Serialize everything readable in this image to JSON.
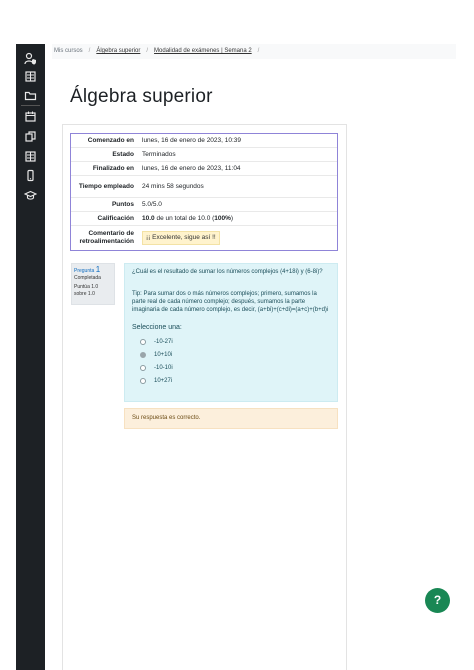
{
  "sidebar": {
    "icons": [
      "user-shield-icon",
      "book-icon",
      "folder-icon",
      "calendar-icon",
      "copy-icon",
      "book-icon",
      "mobile-icon",
      "graduation-cap-icon"
    ]
  },
  "breadcrumb": {
    "items": [
      "Mis cursos",
      "Álgebra superior",
      "Modalidad de exámenes | Semana 2"
    ]
  },
  "page": {
    "title": "Álgebra superior"
  },
  "summary": {
    "rows": [
      {
        "label": "Comenzado en",
        "value": "lunes, 16 de enero de 2023, 10:39"
      },
      {
        "label": "Estado",
        "value": "Terminados"
      },
      {
        "label": "Finalizado en",
        "value": "lunes, 16 de enero de 2023, 11:04"
      },
      {
        "label": "Tiempo empleado",
        "value": "24 mins 58 segundos"
      },
      {
        "label": "Puntos",
        "value": "5.0/5.0"
      },
      {
        "label": "Calificación",
        "value_bold": "10.0",
        "value_mid": " de un total de 10.0 (",
        "value_pct": "100%",
        "value_end": ")"
      },
      {
        "label": "Comentario de retroalimentación",
        "value": "¡¡ Excelente, sigue así !!"
      }
    ]
  },
  "question": {
    "label": "Pregunta",
    "number": "1",
    "status": "Completada",
    "score_line1": "Puntúa 1.0",
    "score_line2": "sobre 1.0",
    "text": "¿Cuál es el resultado de sumar los números complejos (4+18i) y (6-8i)?",
    "tip": "Tip: Para sumar dos o más números complejos; primero, sumamos la parte real de cada número complejo; después, sumamos la parte imaginaria de cada número complejo, es decir, (a+bi)+(c+di)=(a+c)+(b+d)i",
    "prompt": "Seleccione una:",
    "options": [
      "-10-27i",
      "10+10i",
      "-10-10i",
      "10+27i"
    ],
    "selected_index": 1,
    "feedback": "Su respuesta es correcto."
  },
  "help": {
    "label": "?"
  },
  "colors": {
    "sidebar": "#1d2125",
    "summary_border": "#8f84d8",
    "question_bg": "#dff4f8",
    "feedback_bg": "#fcefdc",
    "help_button": "#198754"
  }
}
